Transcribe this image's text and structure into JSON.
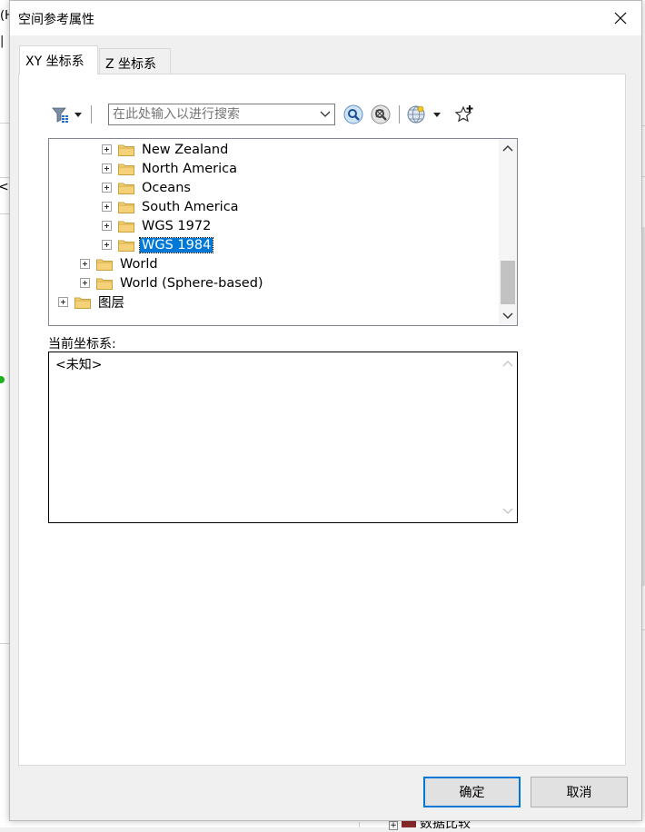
{
  "background_app": {
    "bottom_item_label": "数据比较",
    "edge_glyphs": [
      "(H",
      "|",
      "<",
      "∨"
    ]
  },
  "dialog": {
    "title": "空间参考属性",
    "tabs": [
      {
        "label": "XY 坐标系",
        "active": true
      },
      {
        "label": "Z 坐标系",
        "active": false
      }
    ],
    "toolbar": {
      "filter_icon": "filter-icon",
      "search_placeholder": "在此处输入以进行搜索",
      "search_icon": "search-icon",
      "clear_search_icon": "clear-search-icon",
      "globe_icon": "globe-icon",
      "favorite_icon": "add-favorite-icon"
    },
    "tree": {
      "items": [
        {
          "label": "New Zealand",
          "level": 2,
          "selected": false
        },
        {
          "label": "North America",
          "level": 2,
          "selected": false
        },
        {
          "label": "Oceans",
          "level": 2,
          "selected": false
        },
        {
          "label": "South America",
          "level": 2,
          "selected": false
        },
        {
          "label": "WGS 1972",
          "level": 2,
          "selected": false
        },
        {
          "label": "WGS 1984",
          "level": 2,
          "selected": true
        },
        {
          "label": "World",
          "level": 1,
          "selected": false
        },
        {
          "label": "World (Sphere-based)",
          "level": 1,
          "selected": false
        },
        {
          "label": "图层",
          "level": 0,
          "selected": false
        }
      ]
    },
    "current_label": "当前坐标系:",
    "current_value": "<未知>",
    "buttons": {
      "ok": "确定",
      "cancel": "取消"
    },
    "colors": {
      "selection": "#0078d7",
      "folder": "#f5d27a",
      "primary_border": "#0078d7"
    }
  }
}
